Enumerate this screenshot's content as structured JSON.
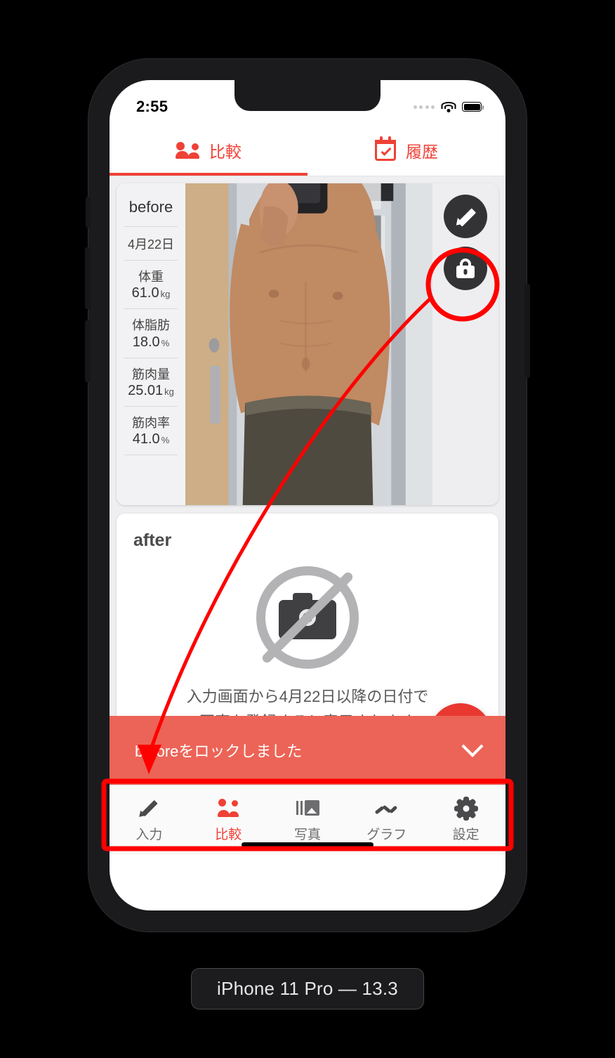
{
  "statusbar": {
    "time": "2:55",
    "signal_icon": "signal-dots-icon",
    "wifi_icon": "wifi-icon",
    "battery_icon": "battery-full-icon"
  },
  "top_tabs": {
    "items": [
      {
        "label": "比較",
        "icon": "people-icon",
        "active": true
      },
      {
        "label": "履歴",
        "icon": "calendar-check-icon",
        "active": false
      }
    ],
    "accent_color": "#ef4136"
  },
  "before_card": {
    "title": "before",
    "date": "4月22日",
    "stats": [
      {
        "label": "体重",
        "value": "61.0",
        "unit": "kg"
      },
      {
        "label": "体脂肪",
        "value": "18.0",
        "unit": "%"
      },
      {
        "label": "筋肉量",
        "value": "25.01",
        "unit": "kg"
      },
      {
        "label": "筋肉率",
        "value": "41.0",
        "unit": "%"
      }
    ],
    "actions": [
      {
        "name": "edit",
        "icon": "pencil-icon"
      },
      {
        "name": "lock",
        "icon": "lock-icon"
      }
    ]
  },
  "after_card": {
    "title": "after",
    "placeholder_icon": "no-camera-icon",
    "message_line1": "入力画面から4月22日以降の日付で",
    "message_line2": "写真を登録すると表示されます"
  },
  "fab": {
    "icon": "check-icon",
    "color": "#e8382f"
  },
  "snackbar": {
    "message": "beforeをロックしました",
    "dismiss_icon": "chevron-down-icon",
    "color": "#ec6457"
  },
  "bottom_nav": {
    "items": [
      {
        "label": "入力",
        "icon": "pencil-icon",
        "active": false
      },
      {
        "label": "比較",
        "icon": "people-icon",
        "active": true
      },
      {
        "label": "写真",
        "icon": "photo-library-icon",
        "active": false
      },
      {
        "label": "グラフ",
        "icon": "line-chart-icon",
        "active": false
      },
      {
        "label": "設定",
        "icon": "gear-icon",
        "active": false
      }
    ]
  },
  "device_caption": "iPhone 11 Pro — 13.3",
  "annotations": {
    "highlight_circle_target": "lock-button",
    "highlight_rect_target": "snackbar",
    "arrow_from": "lock-button",
    "arrow_to": "snackbar",
    "color": "#ff0000"
  }
}
